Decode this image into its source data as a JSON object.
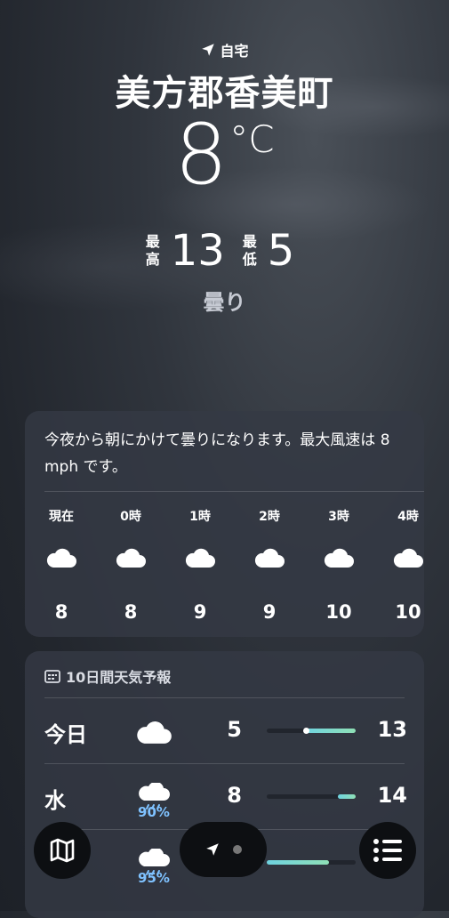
{
  "location": {
    "tag": "自宅",
    "city": "美方郡香美町"
  },
  "current": {
    "temp": "8",
    "unit": "°C",
    "high_label": "最高",
    "high": "13",
    "low_label": "最低",
    "low": "5",
    "condition": "曇り"
  },
  "hourly": {
    "summary": "今夜から朝にかけて曇りになります。最大風速は 8 mph です。",
    "items": [
      {
        "time": "現在",
        "icon": "cloud-icon",
        "temp": "8"
      },
      {
        "time": "0時",
        "icon": "cloud-icon",
        "temp": "8"
      },
      {
        "time": "1時",
        "icon": "cloud-icon",
        "temp": "9"
      },
      {
        "time": "2時",
        "icon": "cloud-icon",
        "temp": "9"
      },
      {
        "time": "3時",
        "icon": "cloud-icon",
        "temp": "10"
      },
      {
        "time": "4時",
        "icon": "cloud-icon",
        "temp": "10"
      }
    ]
  },
  "forecast": {
    "title": "10日間天気予報",
    "days": [
      {
        "day": "今日",
        "icon": "cloud-icon",
        "precip": "",
        "low": "5",
        "high": "13",
        "bar_start": 0.42,
        "bar_end": 1.0,
        "current": 0.38
      },
      {
        "day": "水",
        "icon": "rain-cloud-icon",
        "precip": "90%",
        "low": "8",
        "high": "14",
        "bar_start": 0.8,
        "bar_end": 1.0
      },
      {
        "day": "",
        "icon": "rain-cloud-icon",
        "precip": "95%",
        "low": "",
        "high": "",
        "bar_start": 0.0,
        "bar_end": 0.7
      }
    ]
  },
  "colors": {
    "bar_start": "#6fd3e0",
    "bar_end": "#8fe0b6",
    "precip": "#7fc2ff"
  }
}
